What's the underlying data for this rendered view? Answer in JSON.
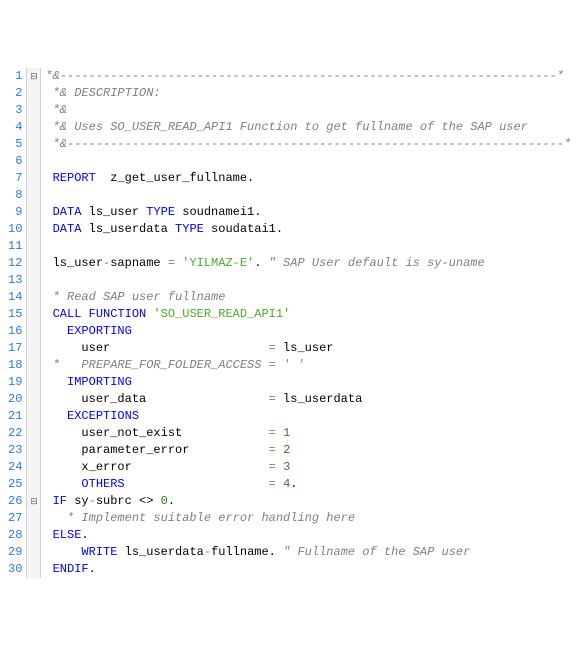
{
  "lines": [
    {
      "n": 1,
      "fold": "⊟",
      "seg": [
        {
          "t": "*&---------------------------------------------------------------------*",
          "c": "cmt"
        }
      ]
    },
    {
      "n": 2,
      "fold": "",
      "seg": [
        {
          "t": " ",
          "c": ""
        },
        {
          "t": "*& DESCRIPTION:",
          "c": "cmt"
        }
      ]
    },
    {
      "n": 3,
      "fold": "",
      "seg": [
        {
          "t": " ",
          "c": ""
        },
        {
          "t": "*&",
          "c": "cmt"
        }
      ]
    },
    {
      "n": 4,
      "fold": "",
      "seg": [
        {
          "t": " ",
          "c": ""
        },
        {
          "t": "*& Uses SO_USER_READ_API1 Function to get fullname of the SAP user",
          "c": "cmt"
        }
      ]
    },
    {
      "n": 5,
      "fold": "",
      "seg": [
        {
          "t": " ",
          "c": ""
        },
        {
          "t": "*&---------------------------------------------------------------------*",
          "c": "cmt"
        }
      ]
    },
    {
      "n": 6,
      "fold": "",
      "seg": []
    },
    {
      "n": 7,
      "fold": "",
      "seg": [
        {
          "t": " ",
          "c": ""
        },
        {
          "t": "REPORT",
          "c": "kw"
        },
        {
          "t": "  z_get_user_fullname.",
          "c": ""
        }
      ]
    },
    {
      "n": 8,
      "fold": "",
      "seg": []
    },
    {
      "n": 9,
      "fold": "",
      "seg": [
        {
          "t": " ",
          "c": ""
        },
        {
          "t": "DATA",
          "c": "kw"
        },
        {
          "t": " ls_user ",
          "c": ""
        },
        {
          "t": "TYPE",
          "c": "kw"
        },
        {
          "t": " soudnamei1.",
          "c": ""
        }
      ]
    },
    {
      "n": 10,
      "fold": "",
      "seg": [
        {
          "t": " ",
          "c": ""
        },
        {
          "t": "DATA",
          "c": "kw"
        },
        {
          "t": " ls_userdata ",
          "c": ""
        },
        {
          "t": "TYPE",
          "c": "kw"
        },
        {
          "t": " soudatai1.",
          "c": ""
        }
      ]
    },
    {
      "n": 11,
      "fold": "",
      "seg": []
    },
    {
      "n": 12,
      "fold": "",
      "seg": [
        {
          "t": " ls_user",
          "c": ""
        },
        {
          "t": "-",
          "c": "cmt"
        },
        {
          "t": "sapname ",
          "c": ""
        },
        {
          "t": "=",
          "c": "cmt"
        },
        {
          "t": " ",
          "c": ""
        },
        {
          "t": "'YILMAZ-E'",
          "c": "str"
        },
        {
          "t": ". ",
          "c": ""
        },
        {
          "t": "\" SAP User default is sy-uname",
          "c": "cmt"
        }
      ]
    },
    {
      "n": 13,
      "fold": "",
      "seg": []
    },
    {
      "n": 14,
      "fold": "",
      "seg": [
        {
          "t": " ",
          "c": ""
        },
        {
          "t": "* Read SAP user fullname",
          "c": "cmt"
        }
      ]
    },
    {
      "n": 15,
      "fold": "",
      "seg": [
        {
          "t": " ",
          "c": ""
        },
        {
          "t": "CALL FUNCTION",
          "c": "kw"
        },
        {
          "t": " ",
          "c": ""
        },
        {
          "t": "'SO_USER_READ_API1'",
          "c": "fn"
        }
      ]
    },
    {
      "n": 16,
      "fold": "",
      "seg": [
        {
          "t": "   ",
          "c": ""
        },
        {
          "t": "EXPORTING",
          "c": "kw"
        }
      ]
    },
    {
      "n": 17,
      "fold": "",
      "seg": [
        {
          "t": "     user                      ",
          "c": ""
        },
        {
          "t": "=",
          "c": "cmt"
        },
        {
          "t": " ls_user",
          "c": ""
        }
      ]
    },
    {
      "n": 18,
      "fold": "",
      "seg": [
        {
          "t": " ",
          "c": ""
        },
        {
          "t": "*   PREPARE_FOR_FOLDER_ACCESS = ' '",
          "c": "cmt"
        }
      ]
    },
    {
      "n": 19,
      "fold": "",
      "seg": [
        {
          "t": "   ",
          "c": ""
        },
        {
          "t": "IMPORTING",
          "c": "kw"
        }
      ]
    },
    {
      "n": 20,
      "fold": "",
      "seg": [
        {
          "t": "     user_data                 ",
          "c": ""
        },
        {
          "t": "=",
          "c": "cmt"
        },
        {
          "t": " ls_userdata",
          "c": ""
        }
      ]
    },
    {
      "n": 21,
      "fold": "",
      "seg": [
        {
          "t": "   ",
          "c": ""
        },
        {
          "t": "EXCEPTIONS",
          "c": "kw"
        }
      ]
    },
    {
      "n": 22,
      "fold": "",
      "seg": [
        {
          "t": "     user_not_exist            ",
          "c": ""
        },
        {
          "t": "=",
          "c": "cmt"
        },
        {
          "t": " ",
          "c": ""
        },
        {
          "t": "1",
          "c": "num"
        }
      ]
    },
    {
      "n": 23,
      "fold": "",
      "seg": [
        {
          "t": "     parameter_error           ",
          "c": ""
        },
        {
          "t": "=",
          "c": "cmt"
        },
        {
          "t": " ",
          "c": ""
        },
        {
          "t": "2",
          "c": "num"
        }
      ]
    },
    {
      "n": 24,
      "fold": "",
      "seg": [
        {
          "t": "     x_error                   ",
          "c": ""
        },
        {
          "t": "=",
          "c": "cmt"
        },
        {
          "t": " ",
          "c": ""
        },
        {
          "t": "3",
          "c": "num"
        }
      ]
    },
    {
      "n": 25,
      "fold": "",
      "seg": [
        {
          "t": "     ",
          "c": ""
        },
        {
          "t": "OTHERS",
          "c": "kw"
        },
        {
          "t": "                    ",
          "c": ""
        },
        {
          "t": "=",
          "c": "cmt"
        },
        {
          "t": " ",
          "c": ""
        },
        {
          "t": "4",
          "c": "num"
        },
        {
          "t": ".",
          "c": ""
        }
      ]
    },
    {
      "n": 26,
      "fold": "⊟",
      "seg": [
        {
          "t": " ",
          "c": ""
        },
        {
          "t": "IF",
          "c": "kw"
        },
        {
          "t": " sy",
          "c": ""
        },
        {
          "t": "-",
          "c": "cmt"
        },
        {
          "t": "subrc <> ",
          "c": ""
        },
        {
          "t": "0",
          "c": "num"
        },
        {
          "t": ".",
          "c": ""
        }
      ]
    },
    {
      "n": 27,
      "fold": "",
      "seg": [
        {
          "t": "   ",
          "c": ""
        },
        {
          "t": "* Implement suitable error handling here",
          "c": "cmt"
        }
      ]
    },
    {
      "n": 28,
      "fold": "",
      "seg": [
        {
          "t": " ",
          "c": ""
        },
        {
          "t": "ELSE",
          "c": "kw"
        },
        {
          "t": ".",
          "c": ""
        }
      ]
    },
    {
      "n": 29,
      "fold": "",
      "seg": [
        {
          "t": "     ",
          "c": ""
        },
        {
          "t": "WRITE",
          "c": "kw"
        },
        {
          "t": " ls_userdata",
          "c": ""
        },
        {
          "t": "-",
          "c": "cmt"
        },
        {
          "t": "fullname. ",
          "c": ""
        },
        {
          "t": "\" Fullname of the SAP user",
          "c": "cmt"
        }
      ]
    },
    {
      "n": 30,
      "fold": "",
      "seg": [
        {
          "t": " ",
          "c": ""
        },
        {
          "t": "ENDIF",
          "c": "kw"
        },
        {
          "t": ".",
          "c": ""
        }
      ]
    }
  ]
}
